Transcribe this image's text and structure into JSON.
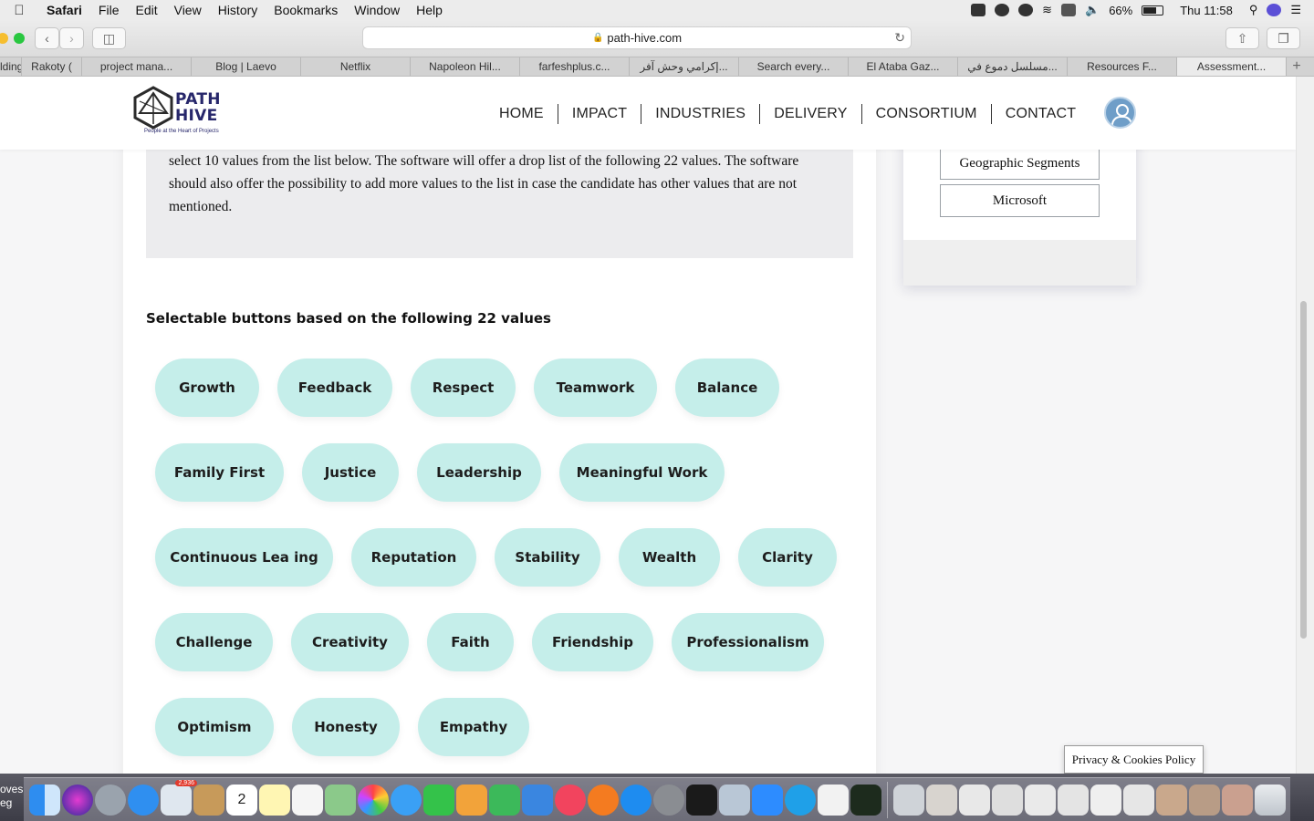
{
  "menubar": {
    "app": "Safari",
    "items": [
      "File",
      "Edit",
      "View",
      "History",
      "Bookmarks",
      "Window",
      "Help"
    ],
    "battery": "66%",
    "clock": "Thu 11:58"
  },
  "browser": {
    "url": "path-hive.com",
    "tabs": [
      "lding",
      "Rakoty (",
      "project mana...",
      "Blog | Laevo",
      "Netflix",
      "Napoleon Hil...",
      "farfeshplus.c...",
      "إكرامي وحش آفر...",
      "Search every...",
      "El Ataba Gaz...",
      "مسلسل دموع في...",
      "Resources F...",
      "Assessment..."
    ],
    "active_tab": 12
  },
  "site": {
    "logo": {
      "line1": "PATH",
      "line2": "HIVE",
      "tagline": "People at the Heart of Projects"
    },
    "nav": [
      "HOME",
      "IMPACT",
      "INDUSTRIES",
      "DELIVERY",
      "CONSORTIUM",
      "CONTACT"
    ]
  },
  "main": {
    "intro_text": "select 10 values from the list below. The software will offer a drop list of the following 22 values. The software should also offer the possibility to add more values to the list in case the candidate has other values that are not mentioned.",
    "heading": "Selectable buttons based on the following 22 values",
    "values": [
      "Growth",
      "Feedback",
      "Respect",
      "Teamwork",
      "Balance",
      "Family First",
      "Justice",
      "Leadership",
      "Meaningful Work",
      "Continuous Lea ing",
      "Reputation",
      "Stability",
      "Wealth",
      "Clarity",
      "Challenge",
      "Creativity",
      "Faith",
      "Friendship",
      "Professionalism",
      "Optimism",
      "Honesty",
      "Empathy"
    ]
  },
  "sidebar": {
    "buttons": [
      "Geographic Segments",
      "Microsoft"
    ]
  },
  "privacy": "Privacy & Cookies Policy",
  "dock": {
    "mail_badge": "2,936",
    "calendar_day": "2",
    "left_text": [
      "oves",
      "eg"
    ]
  }
}
